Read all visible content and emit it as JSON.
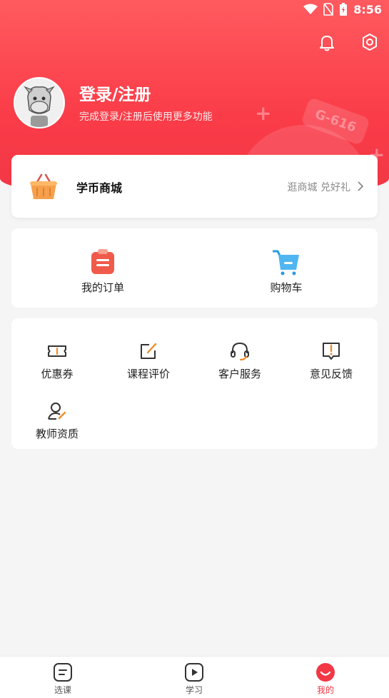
{
  "status_bar": {
    "time": "8:56"
  },
  "profile": {
    "title": "登录/注册",
    "subtitle": "完成登录/注册后使用更多功能"
  },
  "mall": {
    "title": "学币商城",
    "link": "逛商城 兑好礼"
  },
  "orders": {
    "items": [
      {
        "label": "我的订单",
        "icon": "clipboard-icon"
      },
      {
        "label": "购物车",
        "icon": "cart-icon"
      }
    ]
  },
  "services": {
    "items": [
      {
        "label": "优惠券",
        "icon": "ticket-icon"
      },
      {
        "label": "课程评价",
        "icon": "edit-icon"
      },
      {
        "label": "客户服务",
        "icon": "headset-icon"
      },
      {
        "label": "意见反馈",
        "icon": "feedback-icon"
      },
      {
        "label": "教师资质",
        "icon": "teacher-icon"
      }
    ]
  },
  "tabbar": {
    "tabs": [
      {
        "label": "选课",
        "icon": "course-icon",
        "active": false
      },
      {
        "label": "学习",
        "icon": "play-icon",
        "active": false
      },
      {
        "label": "我的",
        "icon": "profile-icon",
        "active": true
      }
    ]
  },
  "colors": {
    "accent": "#f23745",
    "header_gradient_top": "#ff5a5f"
  }
}
